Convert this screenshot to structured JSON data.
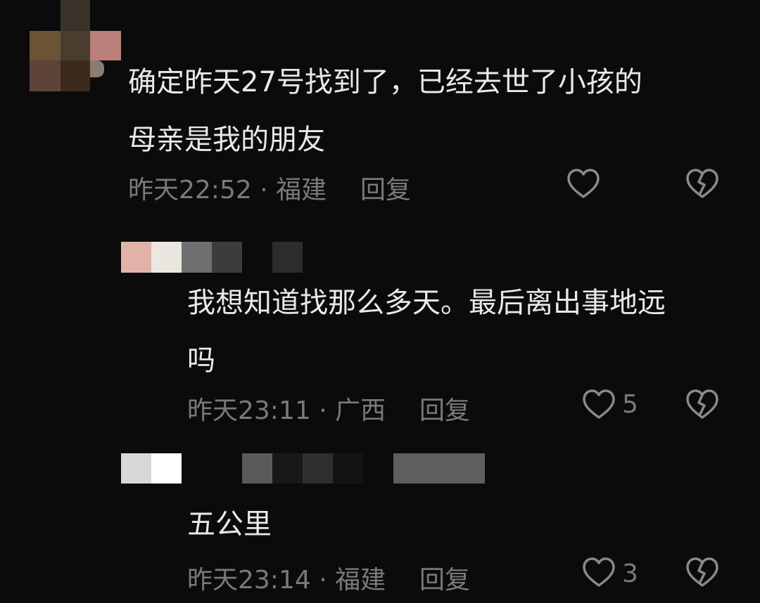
{
  "comments": [
    {
      "text": "确定昨天27号找到了，已经去世了小孩的\n母亲是我的朋友",
      "time": "昨天22:52",
      "separator": "·",
      "location": "福建",
      "reply_label": "回复",
      "like_count": ""
    },
    {
      "text": "我想知道找那么多天。最后离出事地远\n吗",
      "time": "昨天23:11",
      "separator": "·",
      "location": "广西",
      "reply_label": "回复",
      "like_count": "5"
    },
    {
      "text": "五公里",
      "time": "昨天23:14",
      "separator": "·",
      "location": "福建",
      "reply_label": "回复",
      "like_count": "3"
    }
  ],
  "icons": {
    "like": "heart-outline-icon",
    "dislike": "broken-heart-icon"
  },
  "colors": {
    "background": "#0b0b0b",
    "text": "#e9e9e9",
    "meta": "#7a7a7a"
  }
}
